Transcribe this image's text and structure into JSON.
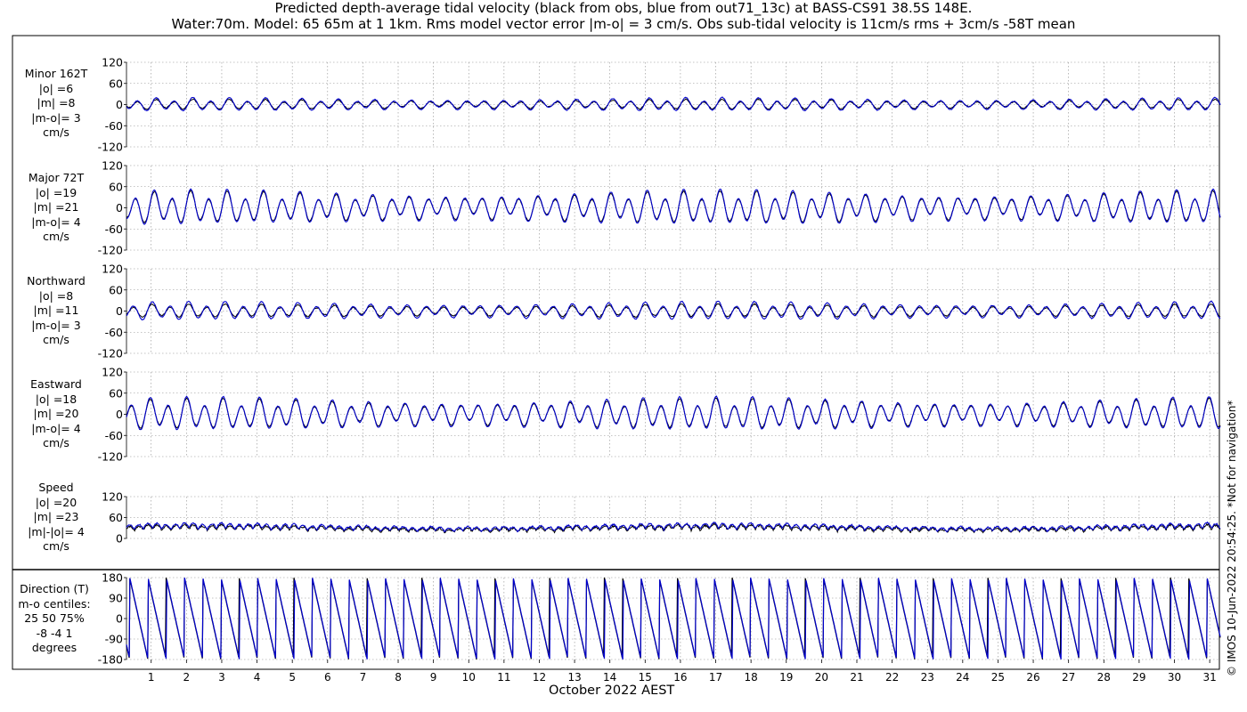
{
  "header": {
    "title_line1": "Predicted depth-average tidal velocity (black from obs, blue from out71_13c) at BASS-CS91 38.5S 148E.",
    "title_line2": "Water:70m. Model: 65 65m at 1 1km. Rms model vector error |m-o| = 3 cm/s. Obs sub-tidal velocity is 11cm/s rms + 3cm/s -58T mean"
  },
  "footer": {
    "xlabel": "October 2022 AEST",
    "side_note": "© IMOS 10-Jun-2022 20:54:25. *Not for navigation*"
  },
  "colors": {
    "obs": "#000000",
    "model": "#0000cc",
    "grid": "#8c8c8c"
  },
  "chart_data": [
    {
      "type": "line",
      "name": "minor",
      "label_lines": [
        "Minor 162T",
        "|o| =6",
        "|m| =8",
        "|m-o|= 3",
        "cm/s"
      ],
      "yticks": [
        "120",
        "60",
        "0",
        "-60",
        "-120"
      ],
      "ylim": [
        -120,
        120
      ],
      "xlim": [
        0.3,
        31.3
      ],
      "amp_obs": 6,
      "amp_model": 8
    },
    {
      "type": "line",
      "name": "major",
      "label_lines": [
        "Major 72T",
        "|o| =19",
        "|m| =21",
        "|m-o|= 4",
        "cm/s"
      ],
      "yticks": [
        "120",
        "60",
        "0",
        "-60",
        "-120"
      ],
      "ylim": [
        -120,
        120
      ],
      "xlim": [
        0.3,
        31.3
      ],
      "amp_obs": 19,
      "amp_model": 21
    },
    {
      "type": "line",
      "name": "northward",
      "label_lines": [
        "Northward",
        "|o| =8",
        "|m| =11",
        "|m-o|= 3",
        "cm/s"
      ],
      "yticks": [
        "120",
        "60",
        "0",
        "-60",
        "-120"
      ],
      "ylim": [
        -120,
        120
      ],
      "xlim": [
        0.3,
        31.3
      ],
      "amp_obs": 8,
      "amp_model": 11
    },
    {
      "type": "line",
      "name": "eastward",
      "label_lines": [
        "Eastward",
        "|o| =18",
        "|m| =20",
        "|m-o|= 4",
        "cm/s"
      ],
      "yticks": [
        "120",
        "60",
        "0",
        "-60",
        "-120"
      ],
      "ylim": [
        -120,
        120
      ],
      "xlim": [
        0.3,
        31.3
      ],
      "amp_obs": 18,
      "amp_model": 20
    },
    {
      "type": "line",
      "name": "speed",
      "label_lines": [
        "Speed",
        "|o| =20",
        "|m| =23",
        "|m|-|o|= 4",
        "cm/s"
      ],
      "yticks": [
        "120",
        "60",
        "0"
      ],
      "ylim": [
        0,
        120
      ],
      "xlim": [
        0.3,
        31.3
      ],
      "amp_obs": 20,
      "amp_model": 23
    },
    {
      "type": "line",
      "name": "direction",
      "label_lines": [
        "Direction (T)",
        "m-o centiles:",
        "25  50  75%",
        "-8 -4  1",
        "degrees"
      ],
      "yticks": [
        "180",
        "90",
        "0",
        "-90",
        "-180"
      ],
      "ylim": [
        -180,
        180
      ],
      "xlim": [
        0.3,
        31.3
      ],
      "centiles": {
        "p25": -8,
        "p50": -4,
        "p75": 1
      }
    }
  ],
  "x_axis": {
    "ticks": [
      1,
      2,
      3,
      4,
      5,
      6,
      7,
      8,
      9,
      10,
      11,
      12,
      13,
      14,
      15,
      16,
      17,
      18,
      19,
      20,
      21,
      22,
      23,
      24,
      25,
      26,
      27,
      28,
      29,
      30,
      31
    ],
    "tick_labels": [
      "1",
      "2",
      "3",
      "4",
      "5",
      "6",
      "7",
      "8",
      "9",
      "10",
      "11",
      "12",
      "13",
      "14",
      "15",
      "16",
      "17",
      "18",
      "19",
      "20",
      "21",
      "22",
      "23",
      "24",
      "25",
      "26",
      "27",
      "28",
      "29",
      "30",
      "31"
    ]
  }
}
